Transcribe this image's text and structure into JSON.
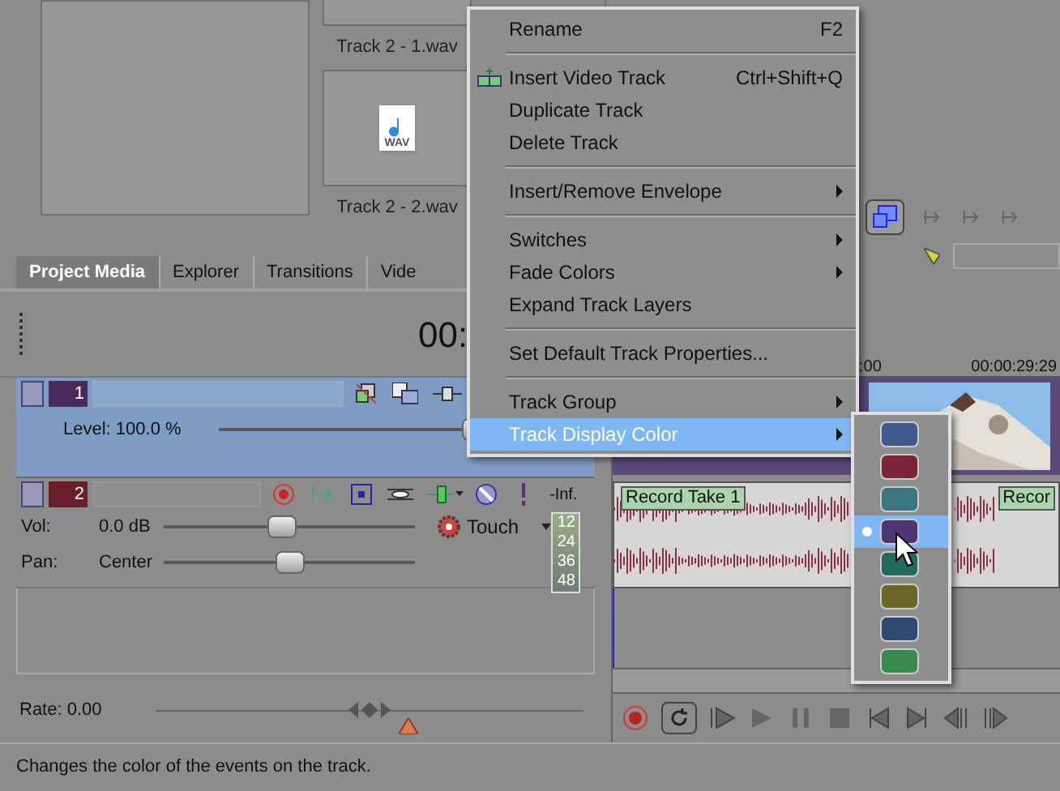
{
  "media_bin": {
    "items": [
      {
        "label": "Track 2 - 1.wav",
        "kind": "blank"
      },
      {
        "label": "Track 2 - 2.wav",
        "kind": "wav"
      }
    ],
    "file_badge": "WAV"
  },
  "tabs": [
    {
      "label": "Project Media",
      "selected": true
    },
    {
      "label": "Explorer",
      "selected": false
    },
    {
      "label": "Transitions",
      "selected": false
    },
    {
      "label": "Vide",
      "selected": false
    }
  ],
  "timecode": "00:",
  "tracks": [
    {
      "kind": "video",
      "number": "1",
      "selected": true,
      "level_label": "Level: 100.0 %",
      "level": 0.94
    },
    {
      "kind": "audio",
      "number": "2",
      "selected": false,
      "volume": {
        "label": "Vol:",
        "value": "0.0 dB",
        "level": 0.47
      },
      "pan": {
        "label": "Pan:",
        "value": "Center",
        "level": 0.5
      },
      "automation": "Touch",
      "meter_label": "-Inf.",
      "meter_scale": [
        "12",
        "24",
        "36",
        "48"
      ]
    }
  ],
  "ruler": [
    ":00",
    "00:00:29:29"
  ],
  "events": [
    {
      "label": "Record Take 1"
    },
    {
      "label": "Recor"
    }
  ],
  "rate": {
    "label": "Rate: 0.00",
    "level": 0.5
  },
  "context_menu": [
    {
      "kind": "item",
      "label": "Rename",
      "shortcut": "F2",
      "submenu": false,
      "highlighted": false
    },
    {
      "kind": "separator"
    },
    {
      "kind": "item",
      "label": "Insert Video Track",
      "shortcut": "Ctrl+Shift+Q",
      "submenu": false,
      "highlighted": false,
      "icon": true
    },
    {
      "kind": "item",
      "label": "Duplicate Track",
      "submenu": false,
      "highlighted": false
    },
    {
      "kind": "item",
      "label": "Delete Track",
      "submenu": false,
      "highlighted": false
    },
    {
      "kind": "separator"
    },
    {
      "kind": "item",
      "label": "Insert/Remove Envelope",
      "submenu": true,
      "highlighted": false
    },
    {
      "kind": "separator"
    },
    {
      "kind": "item",
      "label": "Switches",
      "submenu": true,
      "highlighted": false
    },
    {
      "kind": "item",
      "label": "Fade Colors",
      "submenu": true,
      "highlighted": false
    },
    {
      "kind": "item",
      "label": "Expand Track Layers",
      "submenu": false,
      "highlighted": false
    },
    {
      "kind": "separator"
    },
    {
      "kind": "item",
      "label": "Set Default Track Properties...",
      "submenu": false,
      "highlighted": false
    },
    {
      "kind": "separator"
    },
    {
      "kind": "item",
      "label": "Track Group",
      "submenu": true,
      "highlighted": false
    },
    {
      "kind": "item",
      "label": "Track Display Color",
      "submenu": true,
      "highlighted": true
    }
  ],
  "color_menu": [
    {
      "color": "#3e5a8c",
      "selected": false
    },
    {
      "color": "#7a2636",
      "selected": false
    },
    {
      "color": "#3a7580",
      "selected": false
    },
    {
      "color": "#4e3470",
      "selected": true
    },
    {
      "color": "#226b5c",
      "selected": false
    },
    {
      "color": "#6e6626",
      "selected": false
    },
    {
      "color": "#2e4a72",
      "selected": false
    },
    {
      "color": "#3a8a4c",
      "selected": false
    }
  ],
  "status_text": "Changes the color of the events on the track."
}
